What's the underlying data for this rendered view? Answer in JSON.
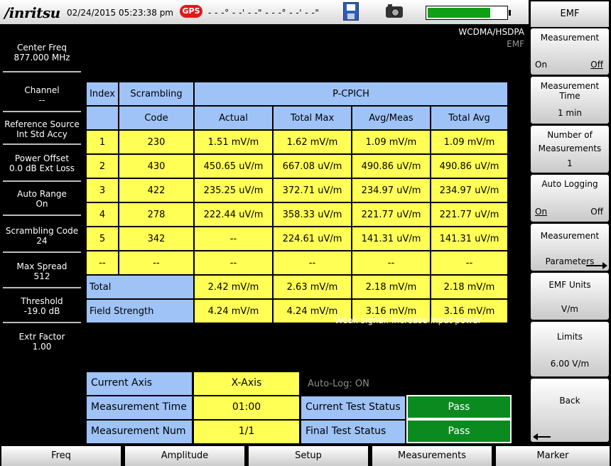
{
  "header": {
    "brand": "/inritsu",
    "datetime": "02/24/2015 05:23:38 pm",
    "gps": "GPS",
    "coordinates": "- - -° - -' - -\" - - -° - -' - -\"",
    "battery_level": 0.8,
    "standard": "WCDMA/HSDPA",
    "mode": "EMF"
  },
  "left_panel": {
    "center_freq": {
      "label": "Center Freq",
      "value": "877.000 MHz"
    },
    "channel": {
      "label": "Channel",
      "value": "--"
    },
    "reference_source": {
      "label": "Reference Source",
      "value": "Int Std Accy"
    },
    "power_offset": {
      "label": "Power Offset",
      "value": "0.0 dB Ext Loss"
    },
    "auto_range": {
      "label": "Auto Range",
      "value": "On"
    },
    "scrambling_code": {
      "label": "Scrambling Code",
      "value": "24"
    },
    "max_spread": {
      "label": "Max Spread",
      "value": "512"
    },
    "threshold": {
      "label": "Threshold",
      "value": "-19.0 dB"
    },
    "extr_factor": {
      "label": "Extr Factor",
      "value": "1.00"
    }
  },
  "table": {
    "headers": {
      "index": "Index",
      "scrambling_1": "Scrambling",
      "scrambling_2": "Code",
      "group": "P-CPICH",
      "actual": "Actual",
      "total_max": "Total Max",
      "avg_meas": "Avg/Meas",
      "total_avg": "Total Avg"
    },
    "rows": [
      [
        "1",
        "230",
        "1.51 mV/m",
        "1.62 mV/m",
        "1.09 mV/m",
        "1.09 mV/m"
      ],
      [
        "2",
        "430",
        "450.65 uV/m",
        "667.08 uV/m",
        "490.86 uV/m",
        "490.86 uV/m"
      ],
      [
        "3",
        "422",
        "235.25 uV/m",
        "372.71 uV/m",
        "234.97 uV/m",
        "234.97 uV/m"
      ],
      [
        "4",
        "278",
        "222.44 uV/m",
        "358.33 uV/m",
        "221.77 uV/m",
        "221.77 uV/m"
      ],
      [
        "5",
        "342",
        "--",
        "224.61 uV/m",
        "141.31 uV/m",
        "141.31 uV/m"
      ],
      [
        "--",
        "--",
        "--",
        "--",
        "--",
        "--"
      ]
    ],
    "total": {
      "label": "Total",
      "values": [
        "2.42 mV/m",
        "2.63 mV/m",
        "2.18 mV/m",
        "2.18 mV/m"
      ]
    },
    "field_strength": {
      "label": "Field Strength",
      "values": [
        "4.24 mV/m",
        "4.24 mV/m",
        "3.16 mV/m",
        "3.16 mV/m"
      ]
    }
  },
  "warning": "Weak signal: Increase input power",
  "info": {
    "current_axis_label": "Current Axis",
    "current_axis_value": "X-Axis",
    "auto_log": "Auto-Log: ON",
    "measurement_time_label": "Measurement Time",
    "measurement_time_value": "01:00",
    "current_test_status_label": "Current Test Status",
    "current_test_status_value": "Pass",
    "measurement_num_label": "Measurement Num",
    "measurement_num_value": "1/1",
    "final_test_status_label": "Final Test Status",
    "final_test_status_value": "Pass"
  },
  "softkeys": {
    "title": "EMF",
    "measurement": {
      "label": "Measurement",
      "on": "On",
      "off": "Off"
    },
    "measurement_time": {
      "label": "Measurement Time",
      "value": "1 min"
    },
    "number_of_measurements": {
      "label1": "Number of",
      "label2": "Measurements",
      "value": "1"
    },
    "auto_logging": {
      "label": "Auto Logging",
      "on": "On",
      "off": "Off"
    },
    "measurement_parameters": {
      "label1": "Measurement",
      "label2": "Parameters"
    },
    "emf_units": {
      "label": "EMF Units",
      "value": "V/m"
    },
    "limits": {
      "label": "Limits",
      "value": "6.00 V/m"
    },
    "back": {
      "label": "Back"
    }
  },
  "bottom_menu": [
    "Freq",
    "Amplitude",
    "Setup",
    "Measurements",
    "Marker"
  ],
  "colors": {
    "header_blue": "#9fc3f7",
    "cell_yellow": "#ffff55",
    "pass_green": "#0b8a20",
    "gps_red": "#e01919"
  }
}
